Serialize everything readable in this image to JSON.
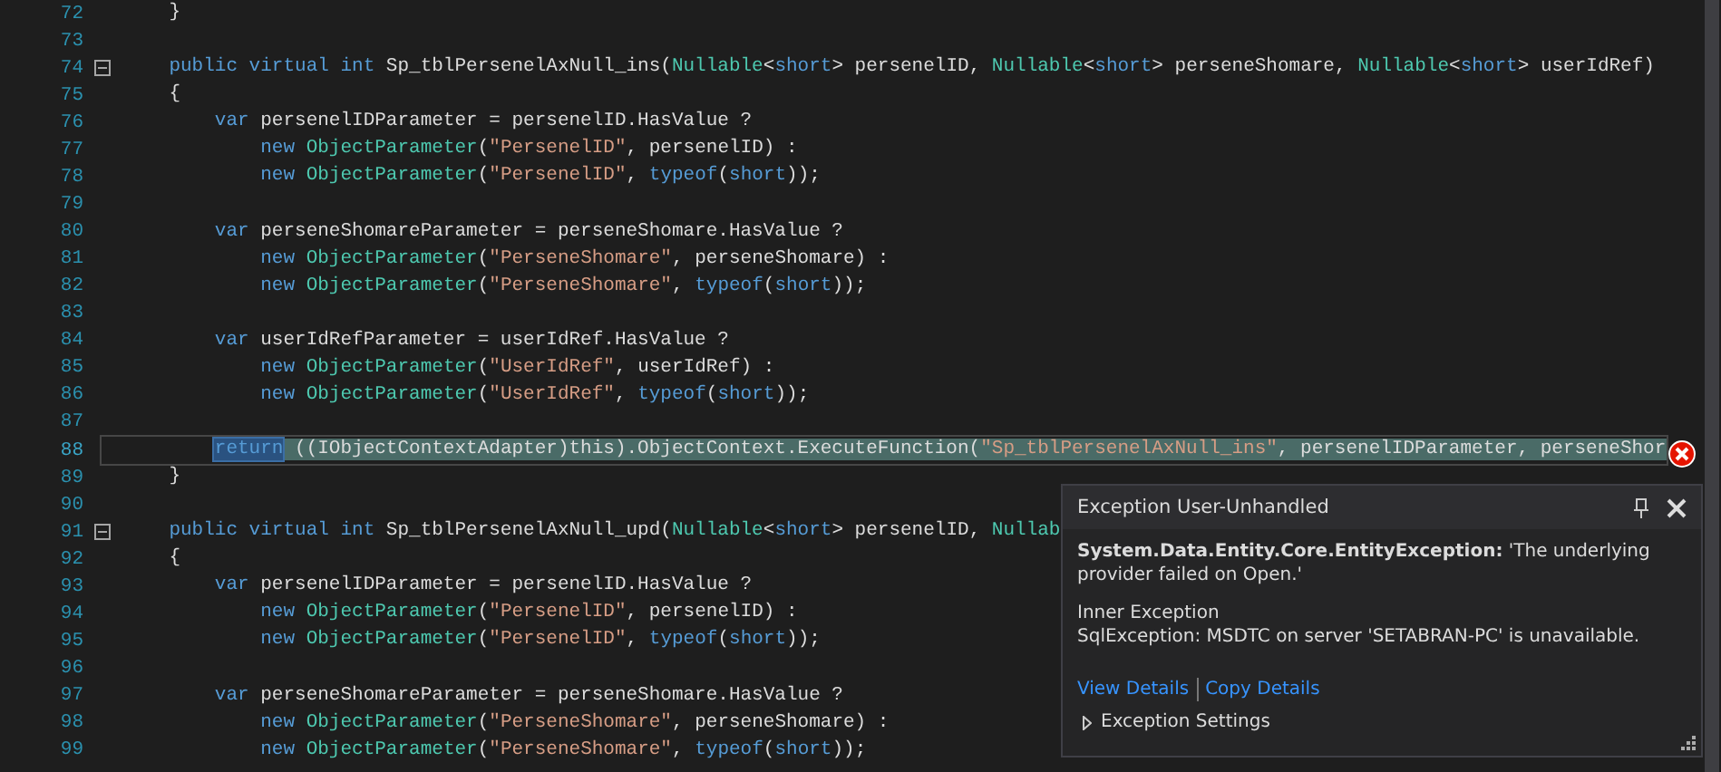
{
  "editor": {
    "lines": [
      {
        "number": "72",
        "fold": false,
        "current": false,
        "tokens": [
          {
            "text": "    }",
            "kind": "p"
          }
        ]
      },
      {
        "number": "73",
        "fold": false,
        "current": false
      },
      {
        "number": "74",
        "fold": true,
        "current": false,
        "tokens": [
          {
            "text": "    public virtual int",
            "kind": "k"
          },
          {
            "text": " Sp_tblPersenelAxNull_ins(",
            "kind": "p"
          },
          {
            "text": "Nullable",
            "kind": "t"
          },
          {
            "text": "<",
            "kind": "p"
          },
          {
            "text": "short",
            "kind": "k"
          },
          {
            "text": "> persenelID, ",
            "kind": "p"
          },
          {
            "text": "Nullable",
            "kind": "t"
          },
          {
            "text": "<",
            "kind": "p"
          },
          {
            "text": "short",
            "kind": "k"
          },
          {
            "text": "> perseneShomare, ",
            "kind": "p"
          },
          {
            "text": "Nullable",
            "kind": "t"
          },
          {
            "text": "<",
            "kind": "p"
          },
          {
            "text": "short",
            "kind": "k"
          },
          {
            "text": "> userIdRef)",
            "kind": "p"
          }
        ]
      },
      {
        "number": "75",
        "fold": false,
        "current": false,
        "tokens": [
          {
            "text": "    {",
            "kind": "p"
          }
        ]
      },
      {
        "number": "76",
        "fold": false,
        "current": false,
        "tokens": [
          {
            "text": "        var",
            "kind": "k"
          },
          {
            "text": " persenelIDParameter = persenelID.HasValue ?",
            "kind": "p"
          }
        ]
      },
      {
        "number": "77",
        "fold": false,
        "current": false,
        "tokens": [
          {
            "text": "            new ",
            "kind": "k"
          },
          {
            "text": "ObjectParameter",
            "kind": "t"
          },
          {
            "text": "(",
            "kind": "p"
          },
          {
            "text": "\"PersenelID\"",
            "kind": "s"
          },
          {
            "text": ", persenelID) :",
            "kind": "p"
          }
        ]
      },
      {
        "number": "78",
        "fold": false,
        "current": false,
        "tokens": [
          {
            "text": "            new ",
            "kind": "k"
          },
          {
            "text": "ObjectParameter",
            "kind": "t"
          },
          {
            "text": "(",
            "kind": "p"
          },
          {
            "text": "\"PersenelID\"",
            "kind": "s"
          },
          {
            "text": ", ",
            "kind": "p"
          },
          {
            "text": "typeof",
            "kind": "k"
          },
          {
            "text": "(",
            "kind": "p"
          },
          {
            "text": "short",
            "kind": "k"
          },
          {
            "text": "));",
            "kind": "p"
          }
        ]
      },
      {
        "number": "79",
        "fold": false,
        "current": false
      },
      {
        "number": "80",
        "fold": false,
        "current": false,
        "tokens": [
          {
            "text": "        var",
            "kind": "k"
          },
          {
            "text": " perseneShomareParameter = perseneShomare.HasValue ?",
            "kind": "p"
          }
        ]
      },
      {
        "number": "81",
        "fold": false,
        "current": false,
        "tokens": [
          {
            "text": "            new ",
            "kind": "k"
          },
          {
            "text": "ObjectParameter",
            "kind": "t"
          },
          {
            "text": "(",
            "kind": "p"
          },
          {
            "text": "\"PerseneShomare\"",
            "kind": "s"
          },
          {
            "text": ", perseneShomare) :",
            "kind": "p"
          }
        ]
      },
      {
        "number": "82",
        "fold": false,
        "current": false,
        "tokens": [
          {
            "text": "            new ",
            "kind": "k"
          },
          {
            "text": "ObjectParameter",
            "kind": "t"
          },
          {
            "text": "(",
            "kind": "p"
          },
          {
            "text": "\"PerseneShomare\"",
            "kind": "s"
          },
          {
            "text": ", ",
            "kind": "p"
          },
          {
            "text": "typeof",
            "kind": "k"
          },
          {
            "text": "(",
            "kind": "p"
          },
          {
            "text": "short",
            "kind": "k"
          },
          {
            "text": "));",
            "kind": "p"
          }
        ]
      },
      {
        "number": "83",
        "fold": false,
        "current": false
      },
      {
        "number": "84",
        "fold": false,
        "current": false,
        "tokens": [
          {
            "text": "        var",
            "kind": "k"
          },
          {
            "text": " userIdRefParameter = userIdRef.HasValue ?",
            "kind": "p"
          }
        ]
      },
      {
        "number": "85",
        "fold": false,
        "current": false,
        "tokens": [
          {
            "text": "            new ",
            "kind": "k"
          },
          {
            "text": "ObjectParameter",
            "kind": "t"
          },
          {
            "text": "(",
            "kind": "p"
          },
          {
            "text": "\"UserIdRef\"",
            "kind": "s"
          },
          {
            "text": ", userIdRef) :",
            "kind": "p"
          }
        ]
      },
      {
        "number": "86",
        "fold": false,
        "current": false,
        "tokens": [
          {
            "text": "            new ",
            "kind": "k"
          },
          {
            "text": "ObjectParameter",
            "kind": "t"
          },
          {
            "text": "(",
            "kind": "p"
          },
          {
            "text": "\"UserIdRef\"",
            "kind": "s"
          },
          {
            "text": ", ",
            "kind": "p"
          },
          {
            "text": "typeof",
            "kind": "k"
          },
          {
            "text": "(",
            "kind": "p"
          },
          {
            "text": "short",
            "kind": "k"
          },
          {
            "text": "));",
            "kind": "p"
          }
        ]
      },
      {
        "number": "87",
        "fold": false,
        "current": false
      },
      {
        "number": "88",
        "fold": false,
        "current": true,
        "tokens": [
          {
            "text": "return",
            "kind": "sel"
          },
          {
            "text": " ((IObjectContextAdapter)this).ObjectContext.ExecuteFunction(",
            "kind": "p"
          },
          {
            "text": "\"Sp_tblPersenelAxNull_ins\"",
            "kind": "s"
          },
          {
            "text": ", persenelIDParameter, perseneShor",
            "kind": "p"
          }
        ]
      },
      {
        "number": "89",
        "fold": false,
        "current": false,
        "tokens": [
          {
            "text": "    }",
            "kind": "p"
          }
        ]
      },
      {
        "number": "90",
        "fold": false,
        "current": false
      },
      {
        "number": "91",
        "fold": true,
        "current": false,
        "tokens": [
          {
            "text": "    public virtual int",
            "kind": "k"
          },
          {
            "text": " Sp_tblPersenelAxNull_upd(",
            "kind": "p"
          },
          {
            "text": "Nullable",
            "kind": "t"
          },
          {
            "text": "<",
            "kind": "p"
          },
          {
            "text": "short",
            "kind": "k"
          },
          {
            "text": "> persenelID, ",
            "kind": "p"
          },
          {
            "text": "Nullab",
            "kind": "t"
          }
        ]
      },
      {
        "number": "92",
        "fold": false,
        "current": false,
        "tokens": [
          {
            "text": "    {",
            "kind": "p"
          }
        ]
      },
      {
        "number": "93",
        "fold": false,
        "current": false,
        "tokens": [
          {
            "text": "        var",
            "kind": "k"
          },
          {
            "text": " persenelIDParameter = persenelID.HasValue ?",
            "kind": "p"
          }
        ]
      },
      {
        "number": "94",
        "fold": false,
        "current": false,
        "tokens": [
          {
            "text": "            new ",
            "kind": "k"
          },
          {
            "text": "ObjectParameter",
            "kind": "t"
          },
          {
            "text": "(",
            "kind": "p"
          },
          {
            "text": "\"PersenelID\"",
            "kind": "s"
          },
          {
            "text": ", persenelID) :",
            "kind": "p"
          }
        ]
      },
      {
        "number": "95",
        "fold": false,
        "current": false,
        "tokens": [
          {
            "text": "            new ",
            "kind": "k"
          },
          {
            "text": "ObjectParameter",
            "kind": "t"
          },
          {
            "text": "(",
            "kind": "p"
          },
          {
            "text": "\"PersenelID\"",
            "kind": "s"
          },
          {
            "text": ", ",
            "kind": "p"
          },
          {
            "text": "typeof",
            "kind": "k"
          },
          {
            "text": "(",
            "kind": "p"
          },
          {
            "text": "short",
            "kind": "k"
          },
          {
            "text": "));",
            "kind": "p"
          }
        ]
      },
      {
        "number": "96",
        "fold": false,
        "current": false
      },
      {
        "number": "97",
        "fold": false,
        "current": false,
        "tokens": [
          {
            "text": "        var",
            "kind": "k"
          },
          {
            "text": " perseneShomareParameter = perseneShomare.HasValue ?",
            "kind": "p"
          }
        ]
      },
      {
        "number": "98",
        "fold": false,
        "current": false,
        "tokens": [
          {
            "text": "            new ",
            "kind": "k"
          },
          {
            "text": "ObjectParameter",
            "kind": "t"
          },
          {
            "text": "(",
            "kind": "p"
          },
          {
            "text": "\"PerseneShomare\"",
            "kind": "s"
          },
          {
            "text": ", perseneShomare) :",
            "kind": "p"
          }
        ]
      },
      {
        "number": "99",
        "fold": false,
        "current": false,
        "tokens": [
          {
            "text": "            new ",
            "kind": "k"
          },
          {
            "text": "ObjectParameter",
            "kind": "t"
          },
          {
            "text": "(",
            "kind": "p"
          },
          {
            "text": "\"PerseneShomare\"",
            "kind": "s"
          },
          {
            "text": ", ",
            "kind": "p"
          },
          {
            "text": "typeof",
            "kind": "k"
          },
          {
            "text": "(",
            "kind": "p"
          },
          {
            "text": "short",
            "kind": "k"
          },
          {
            "text": "));",
            "kind": "p"
          }
        ]
      }
    ]
  },
  "exception_popup": {
    "title": "Exception User-Unhandled",
    "message": "**System.Data.Entity.Core.EntityException:** 'The underlying provider failed on Open.'",
    "inner_title": "Inner Exception",
    "inner_message": "SqlException: MSDTC on server 'SETABRAN-PC' is unavailable.",
    "links": [
      "View Details",
      "Copy Details"
    ],
    "settings": "Exception Settings"
  }
}
